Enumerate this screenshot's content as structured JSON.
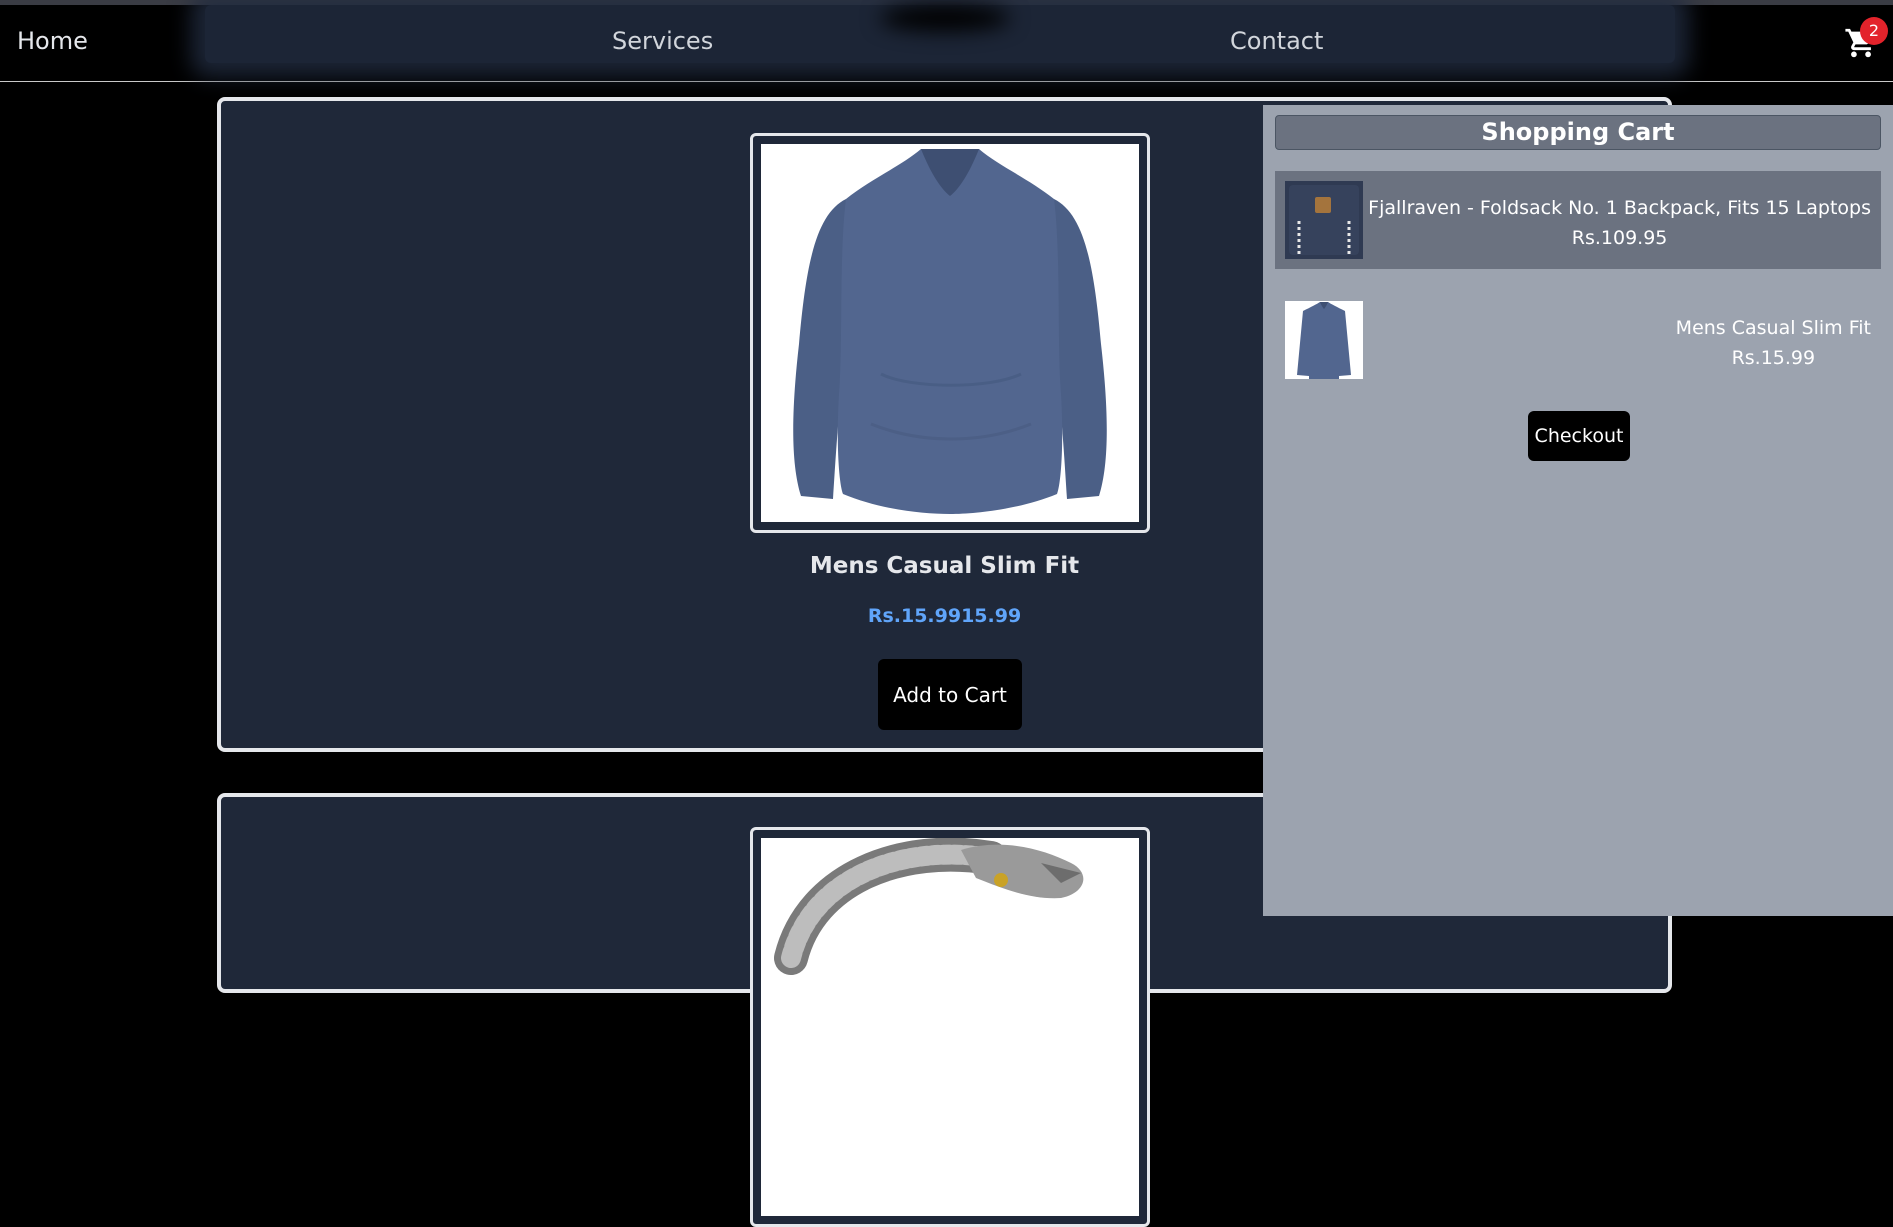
{
  "navbar": {
    "home_label": "Home",
    "services_label": "Services",
    "contact_label": "Contact",
    "cart_icon": "shopping-cart-icon",
    "cart_count": "2",
    "badge_color": "#e3232b"
  },
  "products": [
    {
      "title": "Mens Casual Slim Fit",
      "price": "Rs.15.9915.99",
      "add_to_cart_label": "Add to Cart",
      "image_icon": "tshirt-image"
    },
    {
      "image_icon": "bracelet-image"
    }
  ],
  "cart": {
    "title": "Shopping Cart",
    "items": [
      {
        "name": "Fjallraven - Foldsack No. 1 Backpack, Fits 15 Laptops",
        "price": "Rs.109.95",
        "image_icon": "backpack-image"
      },
      {
        "name": "Mens Casual Slim Fit",
        "price": "Rs.15.99",
        "image_icon": "tshirt-image"
      }
    ],
    "checkout_label": "Checkout"
  },
  "colors": {
    "page_background": "#000000",
    "card_background": "#1f2839",
    "price_color": "#60a5fa",
    "cart_panel": "#9ca3af",
    "cart_header": "#6b7280"
  }
}
